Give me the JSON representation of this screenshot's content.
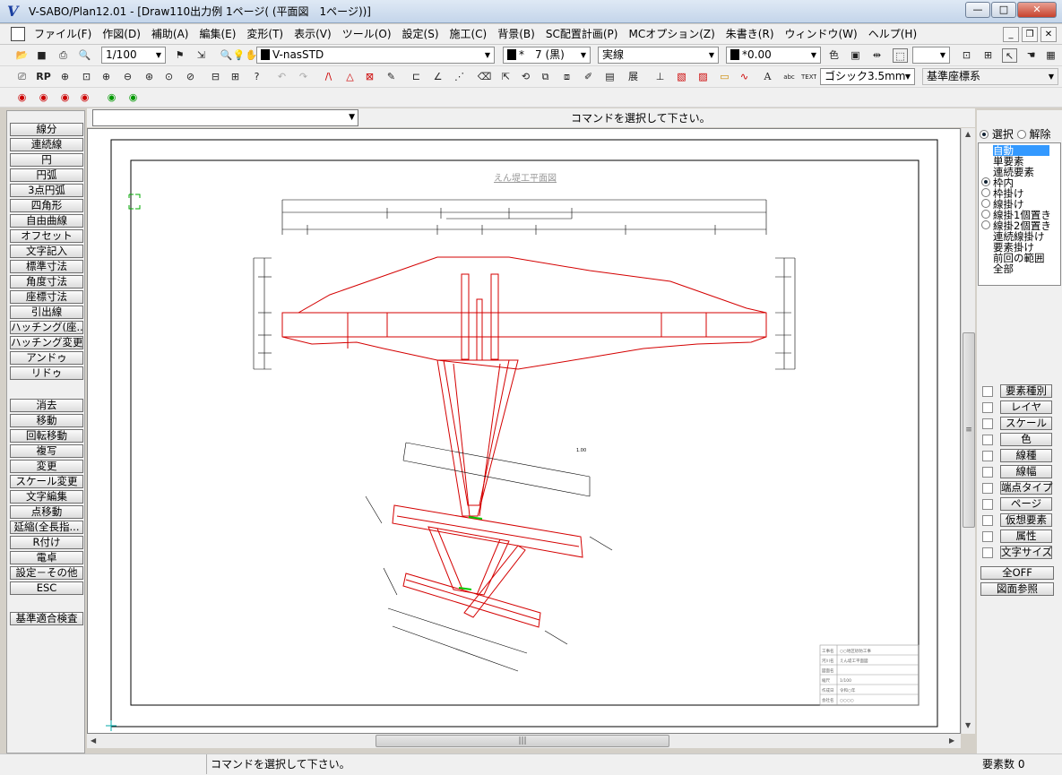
{
  "window": {
    "title": "V-SABO/Plan12.01  - [Draw110出力例 1ページ( (平面図　1ページ))]",
    "app_icon": "V"
  },
  "menu": [
    "ファイル(F)",
    "作図(D)",
    "補助(A)",
    "編集(E)",
    "変形(T)",
    "表示(V)",
    "ツール(O)",
    "設定(S)",
    "施工(C)",
    "背景(B)",
    "SC配置計画(P)",
    "MCオプション(Z)",
    "朱書き(R)",
    "ウィンドウ(W)",
    "ヘルプ(H)"
  ],
  "toolbar": {
    "scale": "1/100",
    "layer": "V-nasSTD",
    "color": "*　7 (黒)",
    "linetype": "実線",
    "linewidth": "*0.00",
    "color_label": "色",
    "font": "ゴシック3.5mm",
    "coord": "基準座標系",
    "rp": "RP",
    "ten": "展",
    "text_icon": "TEXT"
  },
  "command": {
    "placeholder": "",
    "message": "コマンドを選択して下さい。"
  },
  "left_buttons": [
    "線分",
    "連続線",
    "円",
    "円弧",
    "3点円弧",
    "四角形",
    "自由曲線",
    "オフセット",
    "文字記入",
    "標準寸法",
    "角度寸法",
    "座標寸法",
    "引出線",
    "ハッチング(座...",
    "ハッチング変更",
    "アンドゥ",
    "リドゥ",
    "消去",
    "移動",
    "回転移動",
    "複写",
    "変更",
    "スケール変更",
    "文字編集",
    "点移動",
    "延縮(全長指...",
    "R付け",
    "電卓",
    "設定－その他",
    "ESC",
    "基準適合検査"
  ],
  "right_panel": {
    "mode_select": "選択",
    "mode_cancel": "解除",
    "select_items": [
      "自動",
      "単要素",
      "連続要素",
      "枠内",
      "枠掛け",
      "線掛け",
      "線掛1個置き",
      "線掛2個置き",
      "連続線掛け",
      "要素掛け",
      "前回の範囲",
      "全部"
    ],
    "filters": [
      "要素種別",
      "レイヤ",
      "スケール",
      "色",
      "線種",
      "線幅",
      "端点タイプ",
      "ページ",
      "仮想要素",
      "属性",
      "文字サイズ"
    ],
    "all_off": "全OFF",
    "drawing_ref": "図面参照"
  },
  "drawing": {
    "title": "えん堤工平面図",
    "colors": {
      "structure": "#d40000",
      "dims": "#000000",
      "accent": "#00cc00"
    },
    "title_block": [
      "工事名",
      "河川名",
      "図面名",
      "縮尺",
      "作成日",
      "会社名"
    ],
    "title_block_values": [
      "○○地区砂防工事",
      "えん堤工平面図",
      "1/100",
      "令和○年",
      "○○○○"
    ]
  },
  "status": {
    "message": "コマンドを選択して下さい。",
    "element_count": "要素数  0"
  }
}
